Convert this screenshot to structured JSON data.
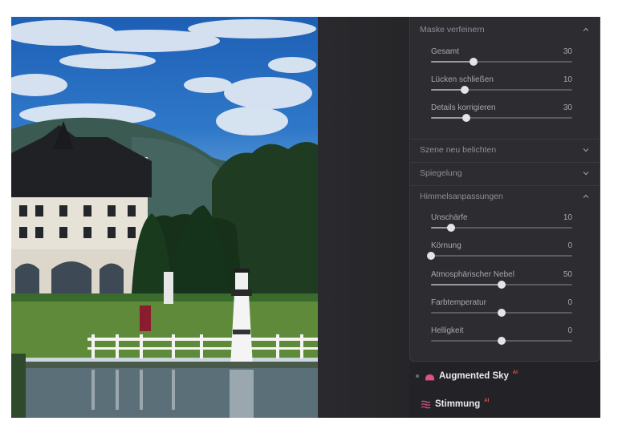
{
  "panel": {
    "mask": {
      "title": "Maske verfeinern",
      "expanded": true,
      "sliders": [
        {
          "label": "Gesamt",
          "value": "30",
          "fraction": 0.3
        },
        {
          "label": "Lücken schließen",
          "value": "10",
          "fraction": 0.24
        },
        {
          "label": "Details korrigieren",
          "value": "30",
          "fraction": 0.25
        }
      ]
    },
    "relight": {
      "title": "Szene neu belichten",
      "expanded": false
    },
    "reflection": {
      "title": "Spiegelung",
      "expanded": false
    },
    "sky": {
      "title": "Himmelsanpassungen",
      "expanded": true,
      "sliders": [
        {
          "label": "Unschärfe",
          "value": "10",
          "fraction": 0.14
        },
        {
          "label": "Körnung",
          "value": "0",
          "fraction": 0.0
        },
        {
          "label": "Atmosphärischer Nebel",
          "value": "50",
          "fraction": 0.5
        },
        {
          "label": "Farbtemperatur",
          "value": "0",
          "fraction": 0.5
        },
        {
          "label": "Helligkeit",
          "value": "0",
          "fraction": 0.5
        }
      ]
    }
  },
  "tools": [
    {
      "label": "Augmented Sky",
      "badge": "AI",
      "icon": "augmented-sky-icon",
      "color": "#e0508a"
    },
    {
      "label": "Stimmung",
      "badge": "AI",
      "icon": "mood-icon",
      "color": "#e0508a"
    }
  ],
  "colors": {
    "panel": "#2c2c31",
    "background": "#232327",
    "accent_ai": "#e8534f"
  }
}
